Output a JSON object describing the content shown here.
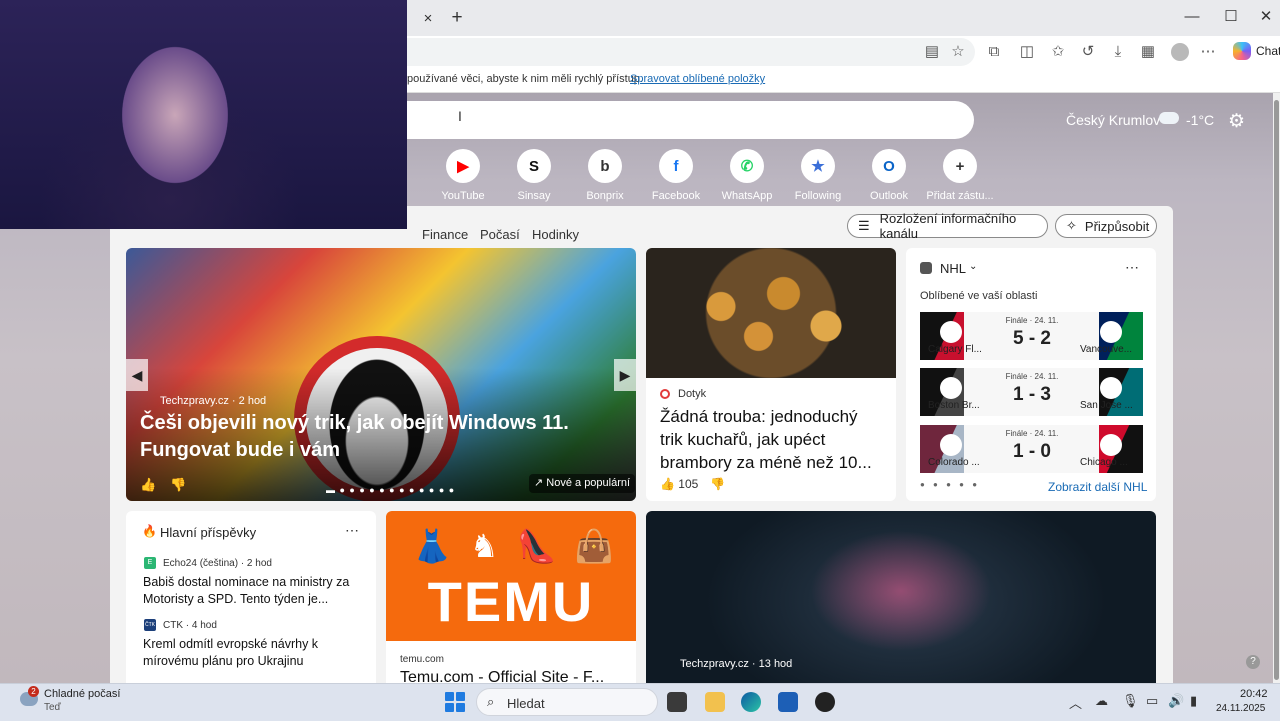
{
  "browser": {
    "tab_close": "×",
    "new_tab": "+",
    "window": {
      "minimize": "—",
      "maximize": "☐",
      "close": "✕"
    },
    "chat_label": "Chat",
    "favorites_text": "používané věci, abyste k nim měli rychlý přístup.",
    "favorites_link": "Spravovat oblíbené položky"
  },
  "header": {
    "weather_city": "Český Krumlov",
    "weather_temp": "-1°C"
  },
  "quick_links": [
    {
      "label": "YouTube",
      "icon": "youtube-icon",
      "glyph": "▶",
      "color": "#ff0000"
    },
    {
      "label": "Sinsay",
      "icon": "sinsay-icon",
      "glyph": "S",
      "color": "#111111"
    },
    {
      "label": "Bonprix",
      "icon": "bonprix-icon",
      "glyph": "b",
      "color": "#333333"
    },
    {
      "label": "Facebook",
      "icon": "facebook-icon",
      "glyph": "f",
      "color": "#1877f2"
    },
    {
      "label": "WhatsApp",
      "icon": "whatsapp-icon",
      "glyph": "✆",
      "color": "#25d366"
    },
    {
      "label": "Following",
      "icon": "following-icon",
      "glyph": "★",
      "color": "#3b6fd8"
    },
    {
      "label": "Outlook",
      "icon": "outlook-icon",
      "glyph": "O",
      "color": "#0a64c8"
    },
    {
      "label": "Přidat zástu...",
      "icon": "add-shortcut-icon",
      "glyph": "+",
      "color": "#333333"
    }
  ],
  "feed_nav": {
    "items": [
      "Finance",
      "Počasí",
      "Hodinky"
    ],
    "layout_button": "Rozložení informačního kanálu",
    "customize_button": "Přizpůsobit"
  },
  "hero": {
    "source": "Techzpravy.cz · 2 hod",
    "title": "Češi objevili nový trik, jak obejít Windows 11. Fungovat bude i vám",
    "badge": "Nové a populární"
  },
  "potato": {
    "source": "Dotyk",
    "title": "Žádná trouba: jednoduchý trik kuchařů, jak upéct brambory za méně než 10...",
    "likes": "105"
  },
  "nhl": {
    "title": "NHL",
    "subtitle": "Oblíbené ve vaší oblasti",
    "games": [
      {
        "status": "Finále · 24. 11.",
        "score": "5 - 2",
        "left_team": "Calgary Fl...",
        "right_team": "Vancouve..."
      },
      {
        "status": "Finále · 24. 11.",
        "score": "1 - 3",
        "left_team": "Boston Br...",
        "right_team": "San Jose ..."
      },
      {
        "status": "Finále · 24. 11.",
        "score": "1 - 0",
        "left_team": "Colorado ...",
        "right_team": "Chicago ..."
      }
    ],
    "more_link": "Zobrazit další NHL"
  },
  "top_posts": {
    "title": "Hlavní příspěvky",
    "items": [
      {
        "source": "Echo24 (čeština) · 2 hod",
        "headline": "Babiš dostal nominace na ministry za Motoristy a SPD. Tento týden je...",
        "icon_text": "E",
        "icon_color": "#2bb673"
      },
      {
        "source": "CTK · 4 hod",
        "headline": "Kreml odmítl evropské návrhy k mírovému plánu pro Ukrajinu",
        "icon_text": "ČTK",
        "icon_color": "#1c3f7a"
      }
    ]
  },
  "temu": {
    "logo": "TEMU",
    "source": "temu.com",
    "title": "Temu.com - Official Site - F..."
  },
  "tech2": {
    "source": "Techzpravy.cz · 13 hod"
  },
  "taskbar": {
    "weather": "Chladné počasí",
    "weather_sub": "Teď",
    "weather_badge": "2",
    "search": "Hledat",
    "time": "20:42",
    "date": "24.11.2025"
  }
}
